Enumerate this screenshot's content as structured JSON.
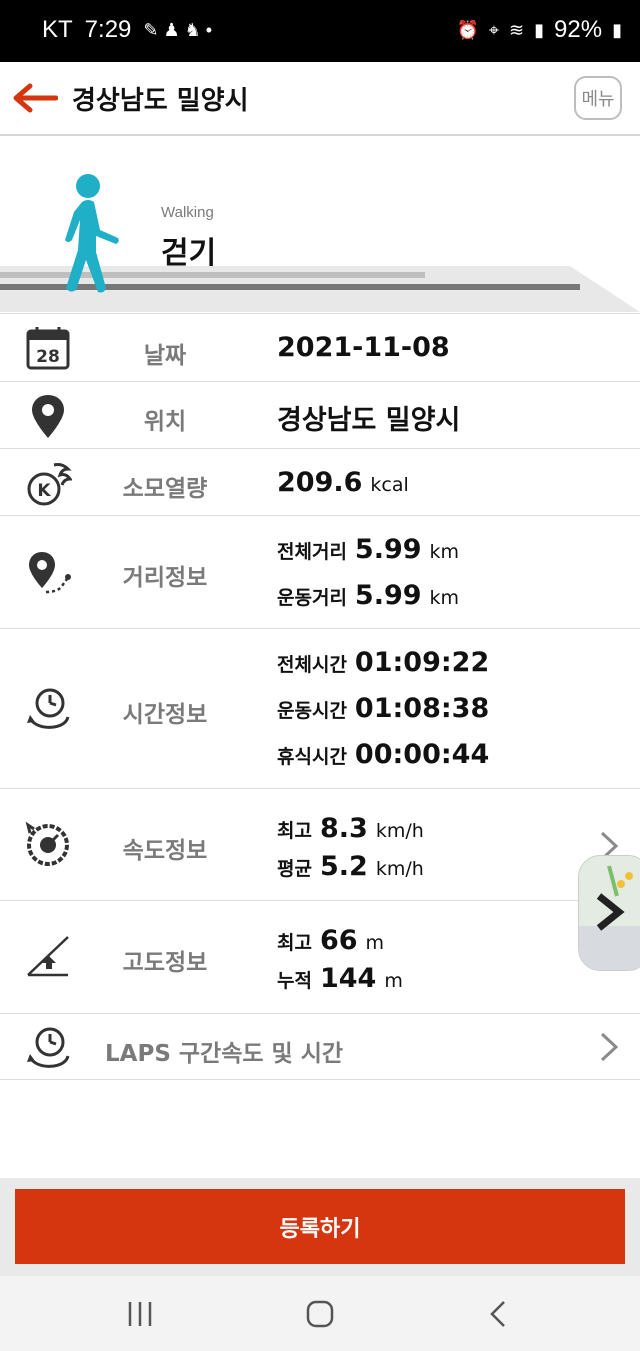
{
  "status_bar": {
    "carrier": "KT",
    "time": "7:29",
    "battery": "92%"
  },
  "header": {
    "title": "경상남도 밀양시",
    "menu_label": "메뉴"
  },
  "activity": {
    "subtitle": "Walking",
    "title": "걷기"
  },
  "calendar_day": "28",
  "rows": {
    "date": {
      "label": "날짜",
      "value": "2021-11-08"
    },
    "location": {
      "label": "위치",
      "value": "경상남도 밀양시"
    },
    "calories": {
      "label": "소모열량",
      "value": "209.6",
      "unit": "kcal"
    },
    "distance": {
      "label": "거리정보",
      "lines": [
        {
          "key": "전체거리",
          "value": "5.99",
          "unit": "km"
        },
        {
          "key": "운동거리",
          "value": "5.99",
          "unit": "km"
        }
      ]
    },
    "time": {
      "label": "시간정보",
      "lines": [
        {
          "key": "전체시간",
          "value": "01:09:22"
        },
        {
          "key": "운동시간",
          "value": "01:08:38"
        },
        {
          "key": "휴식시간",
          "value": "00:00:44"
        }
      ]
    },
    "speed": {
      "label": "속도정보",
      "lines": [
        {
          "key": "최고",
          "value": "8.3",
          "unit": "km/h"
        },
        {
          "key": "평균",
          "value": "5.2",
          "unit": "km/h"
        }
      ]
    },
    "altitude": {
      "label": "고도정보",
      "lines": [
        {
          "key": "최고",
          "value": "66",
          "unit": "m"
        },
        {
          "key": "누적",
          "value": "144",
          "unit": "m"
        }
      ]
    },
    "laps": {
      "label": "LAPS 구간속도 및 시간"
    }
  },
  "register_button": "등록하기",
  "colors": {
    "accent": "#d6360f",
    "back_arrow": "#d6360f",
    "walker": "#1fb0c8",
    "label_gray": "#7a7a7a"
  },
  "icons": {
    "back": "back-arrow-icon",
    "menu": "menu-button",
    "date": "calendar-icon",
    "location": "location-pin-icon",
    "calories": "calorie-flame-icon",
    "distance": "distance-route-icon",
    "time": "clock-timer-icon",
    "speed": "speedometer-icon",
    "altitude": "altitude-slope-icon",
    "laps": "laps-clock-icon"
  }
}
